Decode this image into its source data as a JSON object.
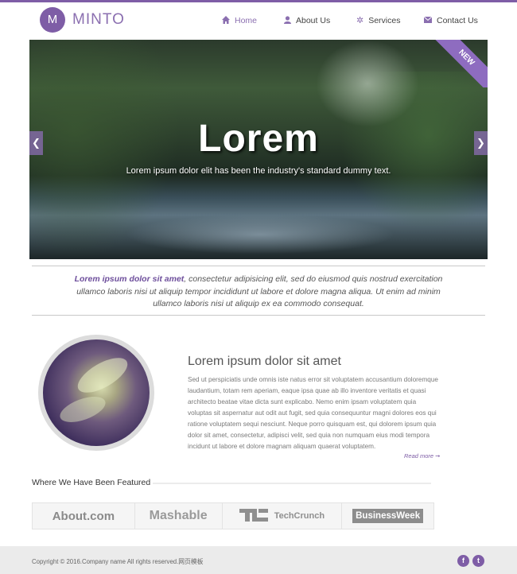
{
  "header": {
    "logo_letter": "M",
    "logo_text": "MINTO",
    "nav": [
      {
        "label": "Home",
        "icon": "home-icon"
      },
      {
        "label": "About Us",
        "icon": "user-icon"
      },
      {
        "label": "Services",
        "icon": "gear-icon"
      },
      {
        "label": "Contact Us",
        "icon": "envelope-icon"
      }
    ]
  },
  "slider": {
    "title": "Lorem",
    "subtitle": "Lorem ipsum dolor elit has been the industry's standard dummy text.",
    "ribbon": "NEW",
    "prev_icon": "chevron-left-icon",
    "next_icon": "chevron-right-icon"
  },
  "quote": {
    "lead": "Lorem ipsum dolor sit amet",
    "text": ", consectetur adipisicing elit, sed do eiusmod quis nostrud exercitation ullamco laboris nisi ut aliquip tempor incididunt ut labore et dolore magna aliqua. Ut enim ad minim ullamco laboris nisi ut aliquip ex ea commodo consequat."
  },
  "about": {
    "title": "Lorem ipsum dolor sit amet",
    "body": "Sed ut perspiciatis unde omnis iste natus error sit voluptatem accusantium doloremque laudantium, totam rem aperiam, eaque ipsa quae ab illo inventore veritatis et quasi architecto beatae vitae dicta sunt explicabo. Nemo enim ipsam voluptatem quia voluptas sit aspernatur aut odit aut fugit, sed quia consequuntur magni dolores eos qui ratione voluptatem sequi nesciunt. Neque porro quisquam est, qui dolorem ipsum quia dolor sit amet, consectetur, adipisci velit, sed quia non numquam eius modi tempora incidunt ut labore et dolore magnam aliquam quaerat voluptatem.",
    "read_more": "Read more ➞"
  },
  "featured": {
    "title": "Where We Have Been Featured",
    "logos": [
      "About.com",
      "Mashable",
      "TechCrunch",
      "BusinessWeek"
    ]
  },
  "footer": {
    "copyright": "Copyright © 2016.Company name All rights reserved.网页模板",
    "social": [
      {
        "label": "f",
        "icon": "facebook-icon"
      },
      {
        "label": "t",
        "icon": "twitter-icon"
      }
    ]
  },
  "colors": {
    "accent": "#7e5da6",
    "footer_bg": "#ebebeb"
  }
}
